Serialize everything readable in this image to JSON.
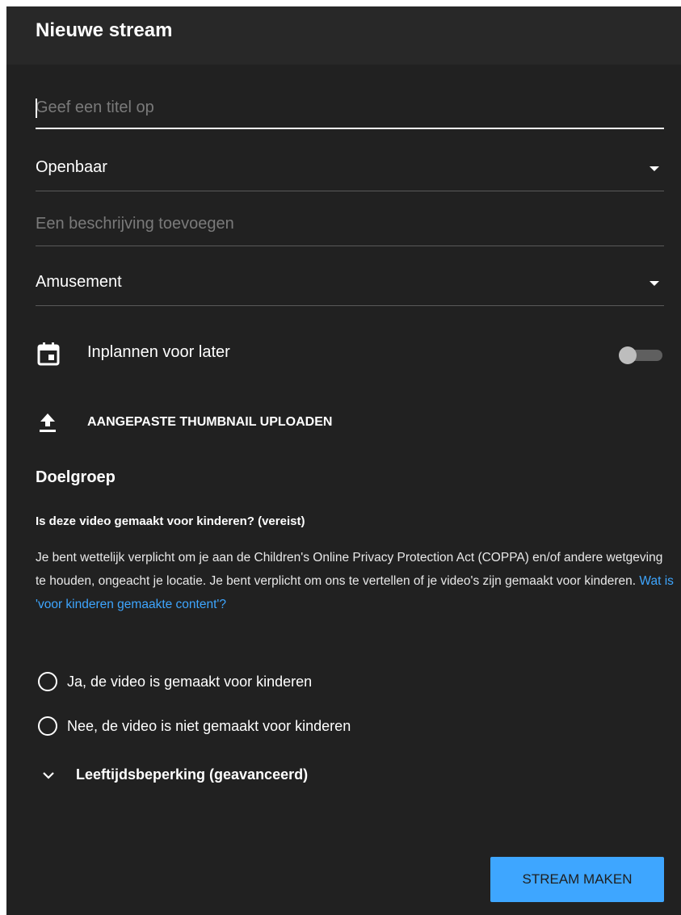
{
  "dialog": {
    "title": "Nieuwe stream"
  },
  "form": {
    "title_input": {
      "placeholder": "Geef een titel op",
      "value": ""
    },
    "visibility": {
      "selected": "Openbaar"
    },
    "description": {
      "placeholder": "Een beschrijving toevoegen"
    },
    "category": {
      "selected": "Amusement"
    },
    "schedule": {
      "label": "Inplannen voor later",
      "enabled": false,
      "icon": "calendar-icon"
    },
    "thumbnail": {
      "label": "AANGEPASTE THUMBNAIL UPLOADEN",
      "icon": "upload-icon"
    }
  },
  "audience": {
    "title": "Doelgroep",
    "question": "Is deze video gemaakt voor kinderen? (vereist)",
    "description": "Je bent wettelijk verplicht om je aan de Children's Online Privacy Protection Act (COPPA) en/of andere wetgeving te houden, ongeacht je locatie. Je bent verplicht om ons te vertellen of je video's zijn gemaakt voor kinderen.",
    "link": "Wat is 'voor kinderen gemaakte content'?",
    "options": [
      {
        "label": "Ja, de video is gemaakt voor kinderen",
        "selected": false
      },
      {
        "label": "Nee, de video is niet gemaakt voor kinderen",
        "selected": false
      }
    ]
  },
  "age_restriction": {
    "label": "Leeftijdsbeperking (geavanceerd)",
    "icon": "chevron-down-icon"
  },
  "actions": {
    "create_label": "STREAM MAKEN"
  },
  "colors": {
    "background": "#212121",
    "header": "#282828",
    "accent": "#3ea6ff"
  }
}
